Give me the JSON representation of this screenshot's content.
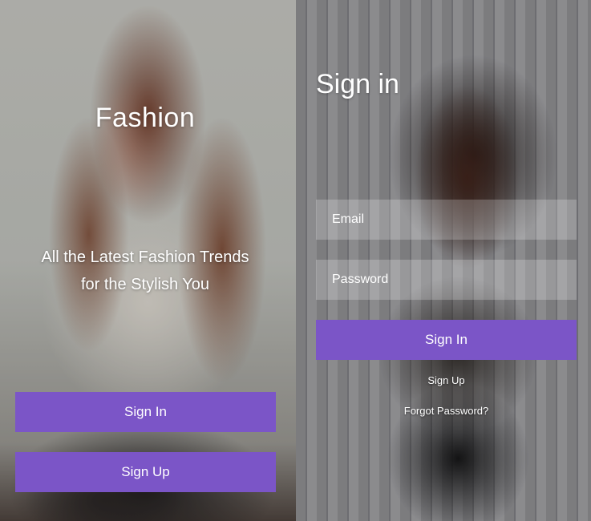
{
  "welcome": {
    "brand": "Fashion",
    "tagline_line1": "All the Latest Fashion Trends",
    "tagline_line2": "for the Stylish You",
    "signin_label": "Sign In",
    "signup_label": "Sign Up"
  },
  "signin_form": {
    "title": "Sign in",
    "email_placeholder": "Email",
    "password_placeholder": "Password",
    "submit_label": "Sign In",
    "signup_link": "Sign Up",
    "forgot_link": "Forgot Password?"
  },
  "colors": {
    "accent": "#7b55c7",
    "text": "#ffffff"
  }
}
